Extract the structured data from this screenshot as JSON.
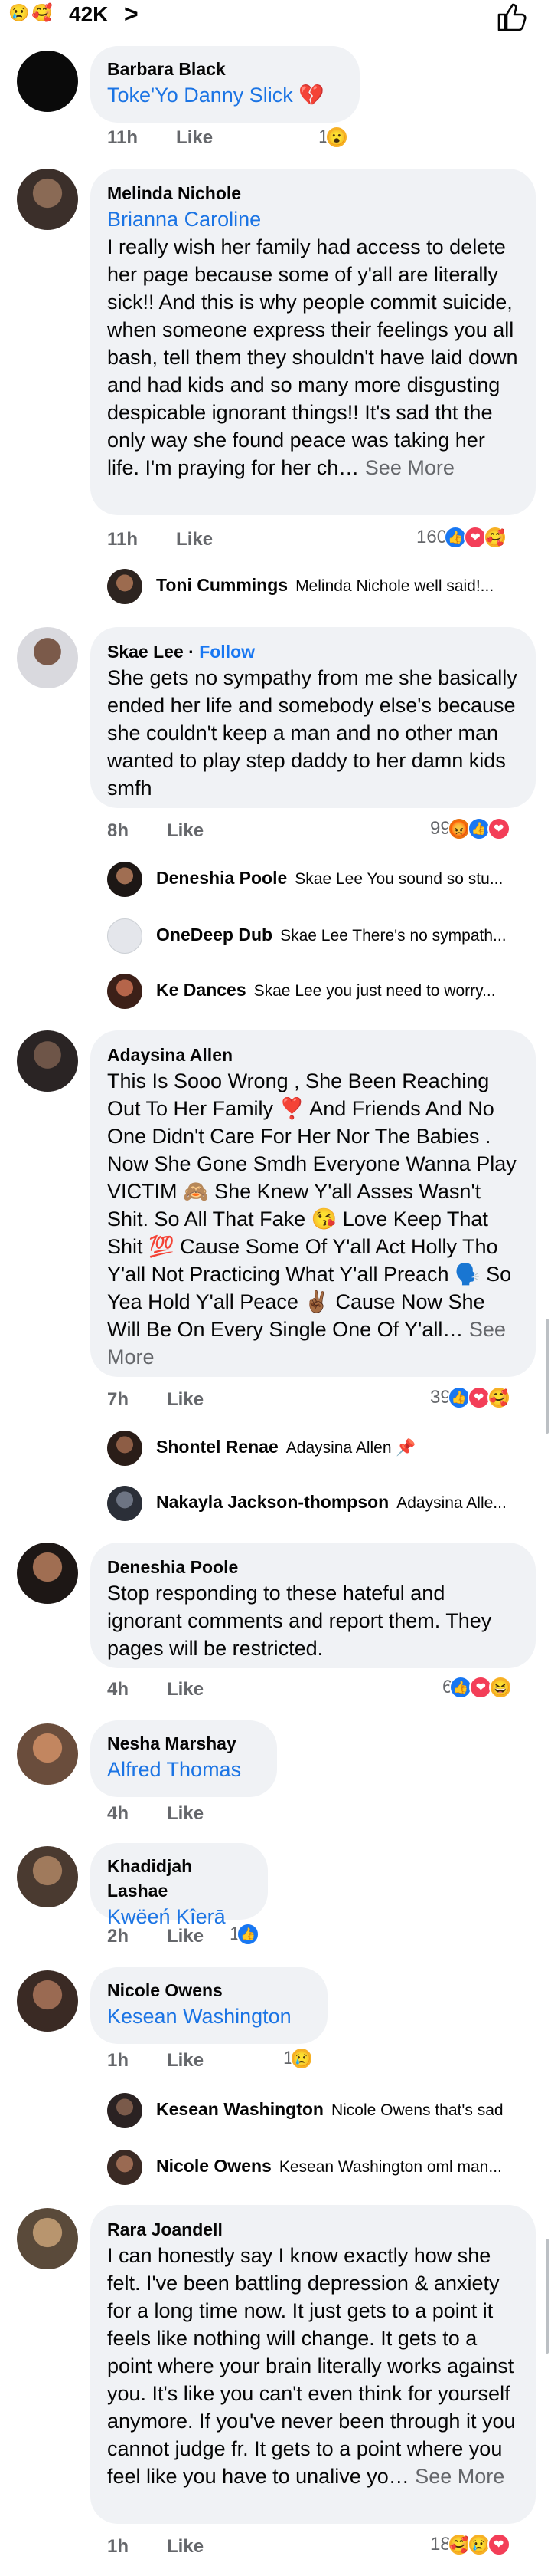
{
  "header": {
    "reaction_emojis": [
      "😢",
      "🥰"
    ],
    "reaction_count": "42K",
    "chevron": ">",
    "like_icon": "thumbs-up-outline-icon"
  },
  "colors": {
    "accent": "#1877f2",
    "bubble": "#f0f2f5",
    "meta": "#65676b",
    "love": "#f33e58",
    "emoji": "#f7b125"
  },
  "comments": [
    {
      "name": "Barbara Black",
      "mention": "Toke'Yo Danny Slick",
      "text": "💔",
      "time": "11h",
      "like_label": "Like",
      "react_count": "1",
      "reactions": [
        "😮"
      ]
    },
    {
      "name": "Melinda Nichole",
      "mention": "Brianna Caroline",
      "text": "I really wish her family had access to delete her page because some of y'all are literally sick!! And this is why people commit suicide, when someone express their feelings you all bash, tell them they shouldn't have laid down and had kids and so many more disgusting despicable ignorant things!! It's sad tht the only way she found peace was taking her life. I'm praying for her ch…",
      "see_more": "See More",
      "time": "11h",
      "like_label": "Like",
      "react_count": "160",
      "reactions": [
        "👍",
        "❤",
        "🥰"
      ],
      "replies": [
        {
          "name": "Toni Cummings",
          "text": "Melinda Nichole well said!..."
        }
      ]
    },
    {
      "name": "Skae Lee",
      "follow": "Follow",
      "text": "She gets no sympathy from me she basically ended her life and somebody else's because she couldn't keep a man and no other man wanted to play step daddy to her damn kids smfh",
      "time": "8h",
      "like_label": "Like",
      "react_count": "99",
      "reactions": [
        "😡",
        "👍",
        "❤"
      ],
      "replies": [
        {
          "name": "Deneshia Poole",
          "text": "Skae Lee You sound so stu..."
        },
        {
          "name": "OneDeep Dub",
          "text": "Skae Lee  There's no sympath..."
        },
        {
          "name": "Ke Dances",
          "text": "Skae Lee you just need to worry..."
        }
      ]
    },
    {
      "name": "Adaysina Allen",
      "text": "This Is Sooo Wrong , She Been Reaching Out To Her Family ❣️ And Friends And No One Didn't Care For Her Nor The Babies . Now She Gone Smdh Everyone Wanna Play VICTIM 🙈 She Knew Y'all Asses Wasn't Shit. So All That Fake 😘 Love Keep That Shit 💯 Cause Some Of Y'all Act Holly Tho Y'all Not Practicing What Y'all Preach 🗣️ So Yea Hold Y'all Peace ✌🏾 Cause Now She Will Be On Every Single One Of Y'all…",
      "see_more": "See More",
      "time": "7h",
      "like_label": "Like",
      "react_count": "39",
      "reactions": [
        "👍",
        "❤",
        "🥰"
      ],
      "replies": [
        {
          "name": "Shontel Renae",
          "text": "Adaysina Allen 📌"
        },
        {
          "name": "Nakayla Jackson-thompson",
          "text": "Adaysina Alle..."
        }
      ]
    },
    {
      "name": "Deneshia Poole",
      "text": "Stop responding to these hateful and ignorant comments and report them. They pages will be restricted.",
      "time": "4h",
      "like_label": "Like",
      "react_count": "6",
      "reactions": [
        "👍",
        "❤",
        "😆"
      ]
    },
    {
      "name": "Nesha Marshay",
      "mention": "Alfred Thomas",
      "time": "4h",
      "like_label": "Like"
    },
    {
      "name": "Khadidjah Lashae",
      "mention": "Kwëeń Kîerā",
      "time": "2h",
      "like_label": "Like",
      "react_count": "1",
      "reactions": [
        "👍"
      ]
    },
    {
      "name": "Nicole Owens",
      "mention": "Kesean Washington",
      "time": "1h",
      "like_label": "Like",
      "react_count": "1",
      "reactions": [
        "😢"
      ],
      "replies": [
        {
          "name": "Kesean Washington",
          "text": "Nicole Owens  that's sad"
        },
        {
          "name": "Nicole Owens",
          "text": "Kesean Washington oml man..."
        }
      ]
    },
    {
      "name": "Rara Joandell",
      "text": "I can honestly say I know exactly how she felt. I've been battling depression & anxiety for a long time now. It just gets to a point it feels like nothing will change. It gets to a point where your brain literally works against you. It's like you can't even think for yourself anymore. If you've never been through it you cannot judge fr. It gets to a point where you feel like you have to unalive yo…",
      "see_more": "See More",
      "time": "1h",
      "like_label": "Like",
      "react_count": "18",
      "reactions": [
        "🥰",
        "😢",
        "❤"
      ]
    }
  ]
}
